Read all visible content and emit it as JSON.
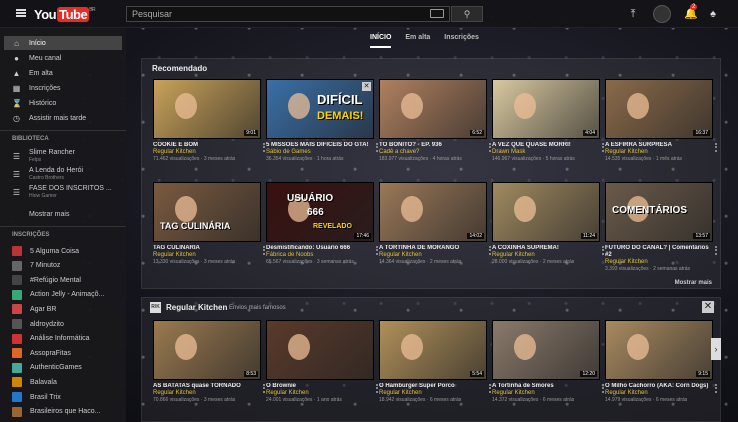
{
  "header": {
    "logo_you": "You",
    "logo_tube": "Tube",
    "logo_region": "BR",
    "search_placeholder": "Pesquisar",
    "notification_count": "2"
  },
  "sidebar": {
    "main": [
      {
        "label": "Início",
        "icon": "home-icon"
      },
      {
        "label": "Meu canal",
        "icon": "person-icon"
      },
      {
        "label": "Em alta",
        "icon": "flame-icon"
      },
      {
        "label": "Inscrições",
        "icon": "subscriptions-icon"
      },
      {
        "label": "Histórico",
        "icon": "history-icon"
      },
      {
        "label": "Assistir mais tarde",
        "icon": "clock-icon"
      }
    ],
    "library_header": "BIBLIOTECA",
    "library": [
      {
        "title": "Slime Rancher",
        "sub": "Felps"
      },
      {
        "title": "A Lenda do Herói",
        "sub": "Castro Brothers"
      },
      {
        "title": "FASE DOS INSCRITOS ...",
        "sub": "Hiow Gamer"
      }
    ],
    "show_more": "Mostrar mais",
    "subs_header": "INSCRIÇÕES",
    "subscriptions": [
      {
        "label": "5 Alguma Coisa",
        "color": "#b33"
      },
      {
        "label": "7 Minutoz",
        "color": "#666"
      },
      {
        "label": "#Refúgio Mental",
        "color": "#444"
      },
      {
        "label": "Action Jelly - Animaçõ...",
        "color": "#3a7"
      },
      {
        "label": "Agar BR",
        "color": "#c44"
      },
      {
        "label": "aldroydzito",
        "color": "#555"
      },
      {
        "label": "Análise Informática",
        "color": "#c33"
      },
      {
        "label": "AssopraFitas",
        "color": "#d62"
      },
      {
        "label": "AuthenticGames",
        "color": "#4a9"
      },
      {
        "label": "Balavala",
        "color": "#c80"
      },
      {
        "label": "Brasil Trix",
        "color": "#27c"
      },
      {
        "label": "Brasileiros que Haco...",
        "color": "#963"
      }
    ]
  },
  "tabs": [
    {
      "label": "INÍCIO",
      "active": true
    },
    {
      "label": "Em alta",
      "active": false
    },
    {
      "label": "Inscrições",
      "active": false
    }
  ],
  "recommended": {
    "title": "Recomendado",
    "more_label": "Mostrar mais",
    "videos": [
      {
        "title": "COOKIE É BOM",
        "channel": "Regular Kitchen",
        "views": "71.462 visualizações · 3 meses atrás",
        "duration": "9:01",
        "bg": "#c9a25a"
      },
      {
        "title": "5 MISSÕES MAIS DIFÍCEIS DO GTA!",
        "channel": "Sábio de Games",
        "views": "36.354 visualizações · 1 hora atrás",
        "duration": "",
        "bg": "#3a6fa8"
      },
      {
        "title": "TÔ BONITO? - EP. 936",
        "channel": "Cadê a chave?",
        "views": "183.977 visualizações · 4 horas atrás",
        "duration": "6:52",
        "bg": "#b08060"
      },
      {
        "title": "A VEZ QUE QUASE MORRI!",
        "channel": "Drawn Mask",
        "views": "146.967 visualizações · 5 horas atrás",
        "duration": "4:04",
        "bg": "#d8c8a0"
      },
      {
        "title": "A ESFIRRA SURPRESA",
        "channel": "Regular Kitchen",
        "views": "14.535 visualizações · 1 mês atrás",
        "duration": "16:37",
        "bg": "#8a6a4a"
      },
      {
        "title": "TAG CULINÁRIA",
        "channel": "Regular Kitchen",
        "views": "13.330 visualizações · 3 meses atrás",
        "duration": "",
        "bg": "#7a5a40"
      },
      {
        "title": "Desmistificando: Usuário 666",
        "channel": "Fábrica de Noobs",
        "views": "65.567 visualizações · 3 semanas atrás",
        "duration": "17:46",
        "bg": "#3a1010"
      },
      {
        "title": "A TORTINHA DE MORANGO",
        "channel": "Regular Kitchen",
        "views": "14.364 visualizações · 2 meses atrás",
        "duration": "14:02",
        "bg": "#9a7858"
      },
      {
        "title": "A COXINHA SUPREMA!",
        "channel": "Regular Kitchen",
        "views": "28.000 visualizações · 2 meses atrás",
        "duration": "11:24",
        "bg": "#a08a60"
      },
      {
        "title": "FUTURO DO CANAL? | Comentários #2",
        "channel": "Regular Kitchen",
        "views": "3.393 visualizações · 2 semanas atrás",
        "duration": "13:57",
        "bg": "#6a5a4a"
      }
    ],
    "thumb_texts": {
      "gta_line1": "DIFÍCIL",
      "gta_line2": "DEMAIS!",
      "tag": "TAG CULINÁRIA",
      "usuario": "USUÁRIO",
      "num": "666",
      "revelado": "REVELADO",
      "coment": "COMENTÁRIOS"
    }
  },
  "channel_shelf": {
    "logo": "R/K",
    "title": "Regular Kitchen",
    "subtitle": "Envios mais famosos",
    "videos": [
      {
        "title": "AS BATATAS quase TORNADO",
        "channel": "Regular Kitchen",
        "views": "70.866 visualizações · 3 meses atrás",
        "duration": "8:53",
        "bg": "#9a7a50"
      },
      {
        "title": "O Brownie",
        "channel": "Regular Kitchen",
        "views": "24.001 visualizações · 1 ano atrás",
        "duration": "",
        "bg": "#5a3a2a"
      },
      {
        "title": "O Hamburger Super Porco",
        "channel": "Regular Kitchen",
        "views": "18.942 visualizações · 6 meses atrás",
        "duration": "5:54",
        "bg": "#b0905a"
      },
      {
        "title": "A Tortinha de Smores",
        "channel": "Regular Kitchen",
        "views": "14.372 visualizações · 6 meses atrás",
        "duration": "12:20",
        "bg": "#8a7a6a"
      },
      {
        "title": "O Milho Cachorro (AKA: Corn Dogs)",
        "channel": "Regular Kitchen",
        "views": "14.979 visualizações · 6 meses atrás",
        "duration": "9:15",
        "bg": "#a88a60"
      }
    ]
  }
}
